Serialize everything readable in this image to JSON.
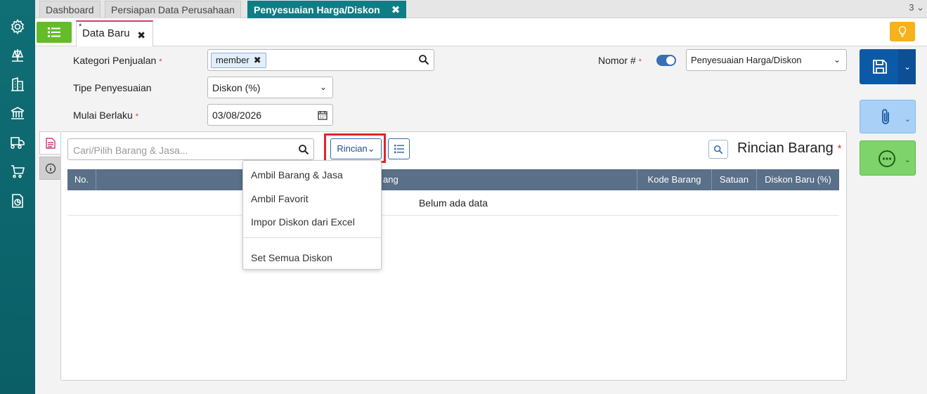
{
  "sidebar": {
    "icons": [
      "gear-icon",
      "scale-icon",
      "building-icon",
      "bank-icon",
      "truck-icon",
      "cart-icon",
      "report-icon"
    ]
  },
  "module_tabs": {
    "items": [
      "Dashboard",
      "Persiapan Data Perusahaan",
      "Penyesuaian Harga/Diskon"
    ],
    "active_close": "✖",
    "count": "3"
  },
  "doc_tab": {
    "star": "*",
    "label": "Data Baru",
    "close": "✖"
  },
  "form": {
    "kategori_label": "Kategori Penjualan",
    "required": "*",
    "kategori_chip": "member",
    "chip_remove": "✖",
    "tipe_label": "Tipe Penyesuaian",
    "tipe_value": "Diskon (%)",
    "mulai_label": "Mulai Berlaku",
    "mulai_value": "03/08/2026",
    "nomor_label": "Nomor #",
    "nomor_value": "Penyesuaian Harga/Diskon"
  },
  "detail": {
    "search_placeholder": "Cari/Pilih Barang & Jasa...",
    "rincian_button": "Rincian",
    "title": "Rincian Barang",
    "columns": [
      "No.",
      "ang",
      "Kode Barang",
      "Satuan",
      "Diskon Baru (%)"
    ],
    "empty_text": "Belum ada data"
  },
  "dropdown": {
    "items": [
      "Ambil Barang & Jasa",
      "Ambil Favorit",
      "Impor Diskon dari Excel",
      "Set Semua Diskon"
    ]
  },
  "colors": {
    "sidebar": "#0f6f75",
    "active_tab": "#0f7d86",
    "save": "#0b5aa8",
    "attach": "#a9d1f7",
    "more": "#7ed36a",
    "highlight": "#e0252b"
  }
}
